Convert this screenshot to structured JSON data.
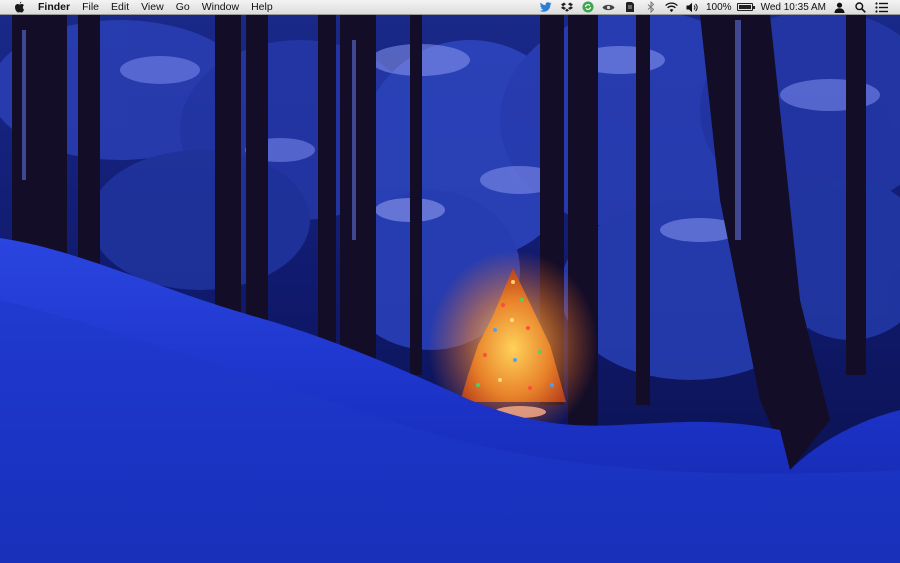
{
  "menubar": {
    "app_name": "Finder",
    "menus": [
      "File",
      "Edit",
      "View",
      "Go",
      "Window",
      "Help"
    ],
    "status_icons": [
      "twitter-icon",
      "dropbox-icon",
      "sync-icon",
      "eye-icon",
      "evernote-icon",
      "bluetooth-icon",
      "wifi-icon",
      "volume-icon"
    ],
    "battery_percent": "100%",
    "battery_level": 1.0,
    "clock": "Wed 10:35 AM",
    "right_icons": [
      "user-icon",
      "spotlight-icon",
      "notification-center-icon"
    ]
  },
  "wallpaper": {
    "subject": "snowy-forest-christmas-tree",
    "colors": {
      "sky": "#0a1150",
      "snow": "#1f3ad8",
      "trunk": "#120c24",
      "tree_glow": "#ff9a2a"
    }
  }
}
